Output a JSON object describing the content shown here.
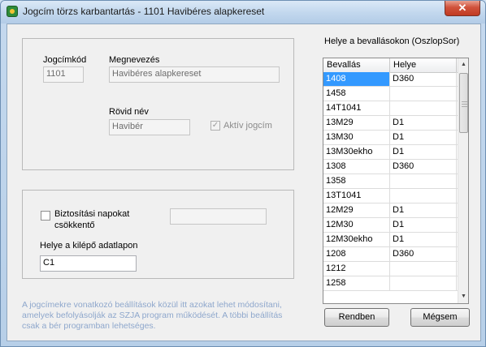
{
  "window": {
    "title": "Jogcím törzs karbantartás - 1101 Havibéres alapkereset",
    "close_glyph": "✕",
    "icon": "app-logo-icon"
  },
  "form": {
    "jogcimkod_label": "Jogcímkód",
    "jogcimkod_value": "1101",
    "megnevezes_label": "Megnevezés",
    "megnevezes_value": "Havibéres alapkereset",
    "rovid_nev_label": "Rövid név",
    "rovid_nev_value": "Havibér",
    "aktiv_label": "Aktív jogcím",
    "aktiv_checked": true,
    "biztositasi_label_line1": "Biztosítási napokat",
    "biztositasi_label_line2": "csökkentő",
    "biztositasi_checked": false,
    "biztositasi_value": "",
    "helye_kilepo_label": "Helye a kilépő adatlapon",
    "helye_kilepo_value": "C1"
  },
  "grid": {
    "title": "Helye a bevallásokon (OszlopSor)",
    "columns": [
      "Bevallás",
      "Helye"
    ],
    "rows": [
      [
        "1408",
        "D360"
      ],
      [
        "1458",
        ""
      ],
      [
        "14T1041",
        ""
      ],
      [
        "13M29",
        "D1"
      ],
      [
        "13M30",
        "D1"
      ],
      [
        "13M30ekho",
        "D1"
      ],
      [
        "1308",
        "D360"
      ],
      [
        "1358",
        ""
      ],
      [
        "13T1041",
        ""
      ],
      [
        "12M29",
        "D1"
      ],
      [
        "12M30",
        "D1"
      ],
      [
        "12M30ekho",
        "D1"
      ],
      [
        "1208",
        "D360"
      ],
      [
        "1212",
        ""
      ],
      [
        "1258",
        ""
      ]
    ],
    "selected_row": 0,
    "scroll_up": "▲",
    "scroll_down": "▼"
  },
  "info_text": "A jogcímekre vonatkozó beállítások közül itt azokat lehet módosítani, amelyek befolyásolják az SZJA program működését. A többi beállítás csak a bér programban lehetséges.",
  "buttons": {
    "ok": "Rendben",
    "cancel": "Mégsem"
  },
  "colors": {
    "selection": "#3399ff",
    "info_text": "#8ea7cc",
    "close_button": "#c8442c"
  }
}
